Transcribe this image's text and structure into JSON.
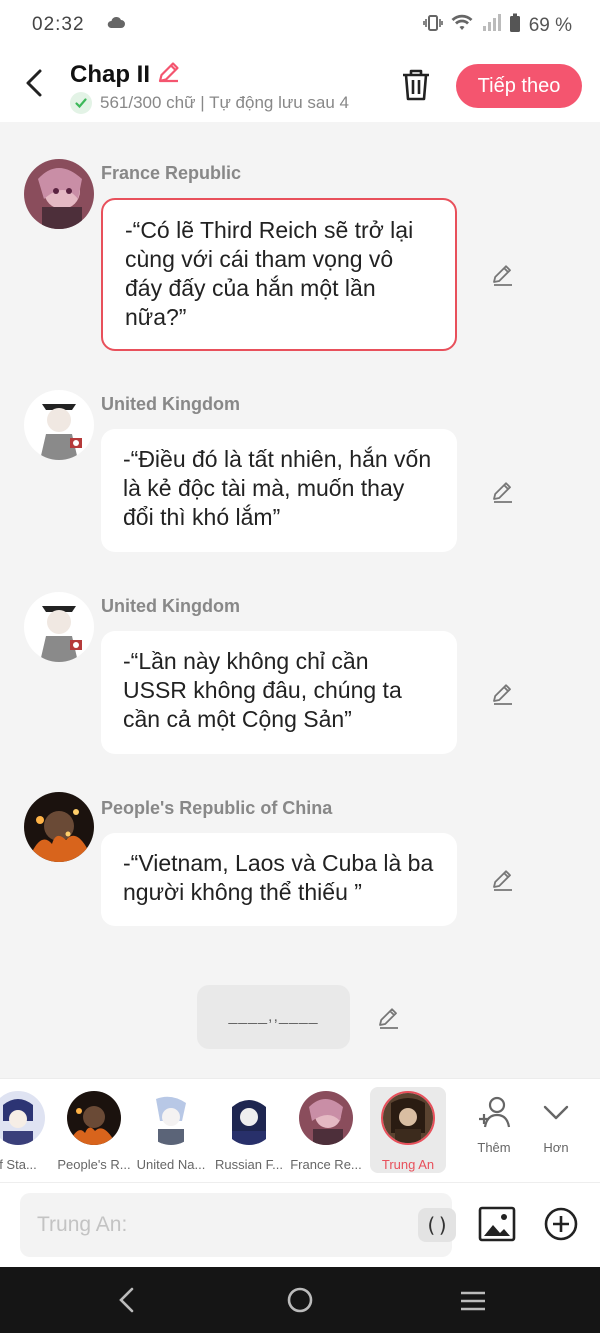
{
  "status_bar": {
    "time": "02:32",
    "battery": "69 %"
  },
  "header": {
    "title": "Chap II",
    "subtitle": "561/300 chữ | Tự động lưu sau 4",
    "next_label": "Tiếp theo"
  },
  "messages": [
    {
      "sender": "France Republic",
      "text": "-“Có lẽ Third Reich sẽ trở lại cùng với cái tham vọng vô đáy đấy của hắn một lần nữa?”",
      "selected": true
    },
    {
      "sender": "United Kingdom",
      "text": "-“Điều đó là tất nhiên, hắn vốn là kẻ độc tài mà, muốn thay đổi thì khó lắm”",
      "selected": false
    },
    {
      "sender": "United Kingdom",
      "text": "-“Lần này không chỉ cần USSR không đâu, chúng ta cần cả một Cộng Sản”",
      "selected": false
    },
    {
      "sender": "People's Republic of China",
      "text": "-“Vietnam, Laos và Cuba là ba người không thể thiếu ”",
      "selected": false
    }
  ],
  "narration": "____,,____",
  "characters": [
    {
      "name": "f Sta..."
    },
    {
      "name": "People's R..."
    },
    {
      "name": "United Na..."
    },
    {
      "name": "Russian F..."
    },
    {
      "name": "France Re..."
    },
    {
      "name": "Trung An"
    }
  ],
  "tools": {
    "add_label": "Thêm",
    "more_label": "Hơn"
  },
  "input": {
    "placeholder": "Trung An:",
    "paren_label": "()"
  },
  "colors": {
    "accent": "#f4556f",
    "selected_border": "#e8505b"
  }
}
